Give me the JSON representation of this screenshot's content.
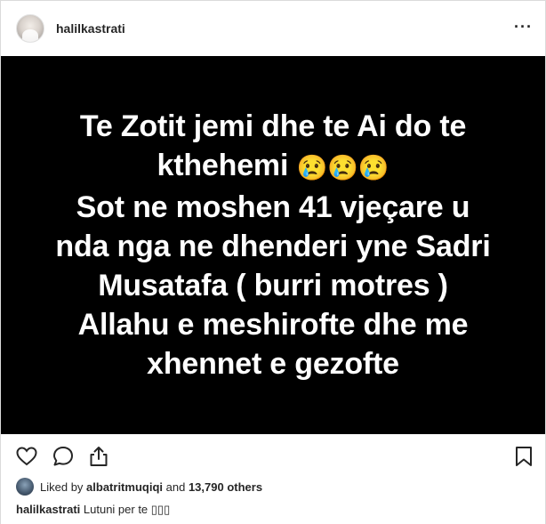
{
  "header": {
    "username": "halilkastrati",
    "more_label": "···"
  },
  "post_image": {
    "line1": "Te Zotit jemi dhe te Ai do te",
    "line2_text": "kthehemi",
    "line2_emojis": "😢😢😢",
    "line3": "Sot ne moshen 41 vjeçare u",
    "line4": "nda nga ne dhenderi yne Sadri",
    "line5": "Musatafa ( burri motres )",
    "line6": "Allahu e meshirofte dhe me",
    "line7": "xhennet e gezofte"
  },
  "actions": {
    "like_icon": "heart-icon",
    "comment_icon": "comment-icon",
    "share_icon": "share-icon",
    "save_icon": "bookmark-icon"
  },
  "likes": {
    "prefix": "Liked by",
    "user": "albatritmuqiqi",
    "middle": "and",
    "count": "13,790 others"
  },
  "caption": {
    "username": "halilkastrati",
    "text": "Lutuni per te ▯▯▯"
  }
}
